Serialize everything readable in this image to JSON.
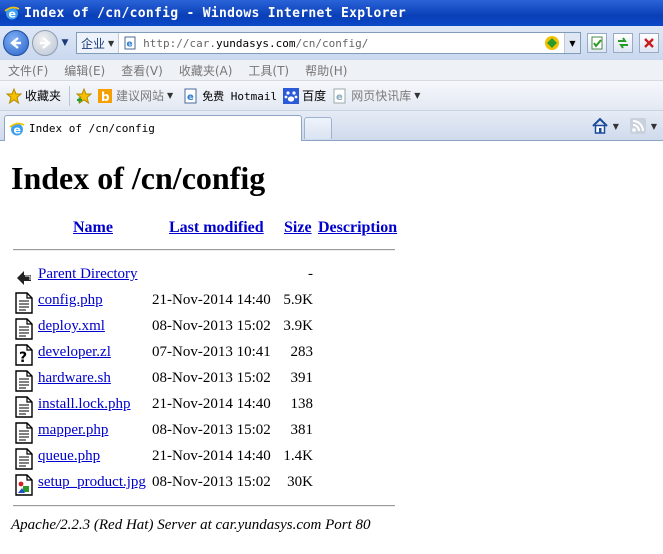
{
  "window": {
    "title": "Index of /cn/config - Windows Internet Explorer"
  },
  "addressbar": {
    "zone_label": "企业",
    "url_prefix": "http://car.",
    "url_domain": "yundasys.com",
    "url_path": "/cn/config/"
  },
  "menubar": {
    "items": [
      "文件(F)",
      "编辑(E)",
      "查看(V)",
      "收藏夹(A)",
      "工具(T)",
      "帮助(H)"
    ]
  },
  "favorites": {
    "label": "收藏夹",
    "items": [
      {
        "label": "建议网站",
        "has_menu": true
      },
      {
        "label": "免费 Hotmail",
        "has_menu": false
      },
      {
        "label": "百度",
        "has_menu": false
      },
      {
        "label": "网页快讯库",
        "has_menu": true
      }
    ]
  },
  "tab": {
    "label": "Index of /cn/config"
  },
  "page": {
    "title": "Index of /cn/config",
    "columns": {
      "name": "Name",
      "modified": "Last modified",
      "size": "Size",
      "description": "Description"
    },
    "parent": {
      "name": "Parent Directory",
      "size": "-"
    },
    "files": [
      {
        "name": "config.php",
        "modified": "21-Nov-2014 14:40",
        "size": "5.9K",
        "icon": "text-file-icon"
      },
      {
        "name": "deploy.xml",
        "modified": "08-Nov-2013 15:02",
        "size": "3.9K",
        "icon": "text-file-icon"
      },
      {
        "name": "developer.zl",
        "modified": "07-Nov-2013 10:41",
        "size": "283",
        "icon": "unknown-file-icon"
      },
      {
        "name": "hardware.sh",
        "modified": "08-Nov-2013 15:02",
        "size": "391",
        "icon": "text-file-icon"
      },
      {
        "name": "install.lock.php",
        "modified": "21-Nov-2014 14:40",
        "size": "138",
        "icon": "text-file-icon"
      },
      {
        "name": "mapper.php",
        "modified": "08-Nov-2013 15:02",
        "size": "381",
        "icon": "text-file-icon"
      },
      {
        "name": "queue.php",
        "modified": "21-Nov-2014 14:40",
        "size": "1.4K",
        "icon": "text-file-icon"
      },
      {
        "name": "setup_product.jpg",
        "modified": "08-Nov-2013 15:02",
        "size": "30K",
        "icon": "image-file-icon"
      }
    ],
    "address": "Apache/2.2.3 (Red Hat) Server at car.yundasys.com Port 80"
  }
}
